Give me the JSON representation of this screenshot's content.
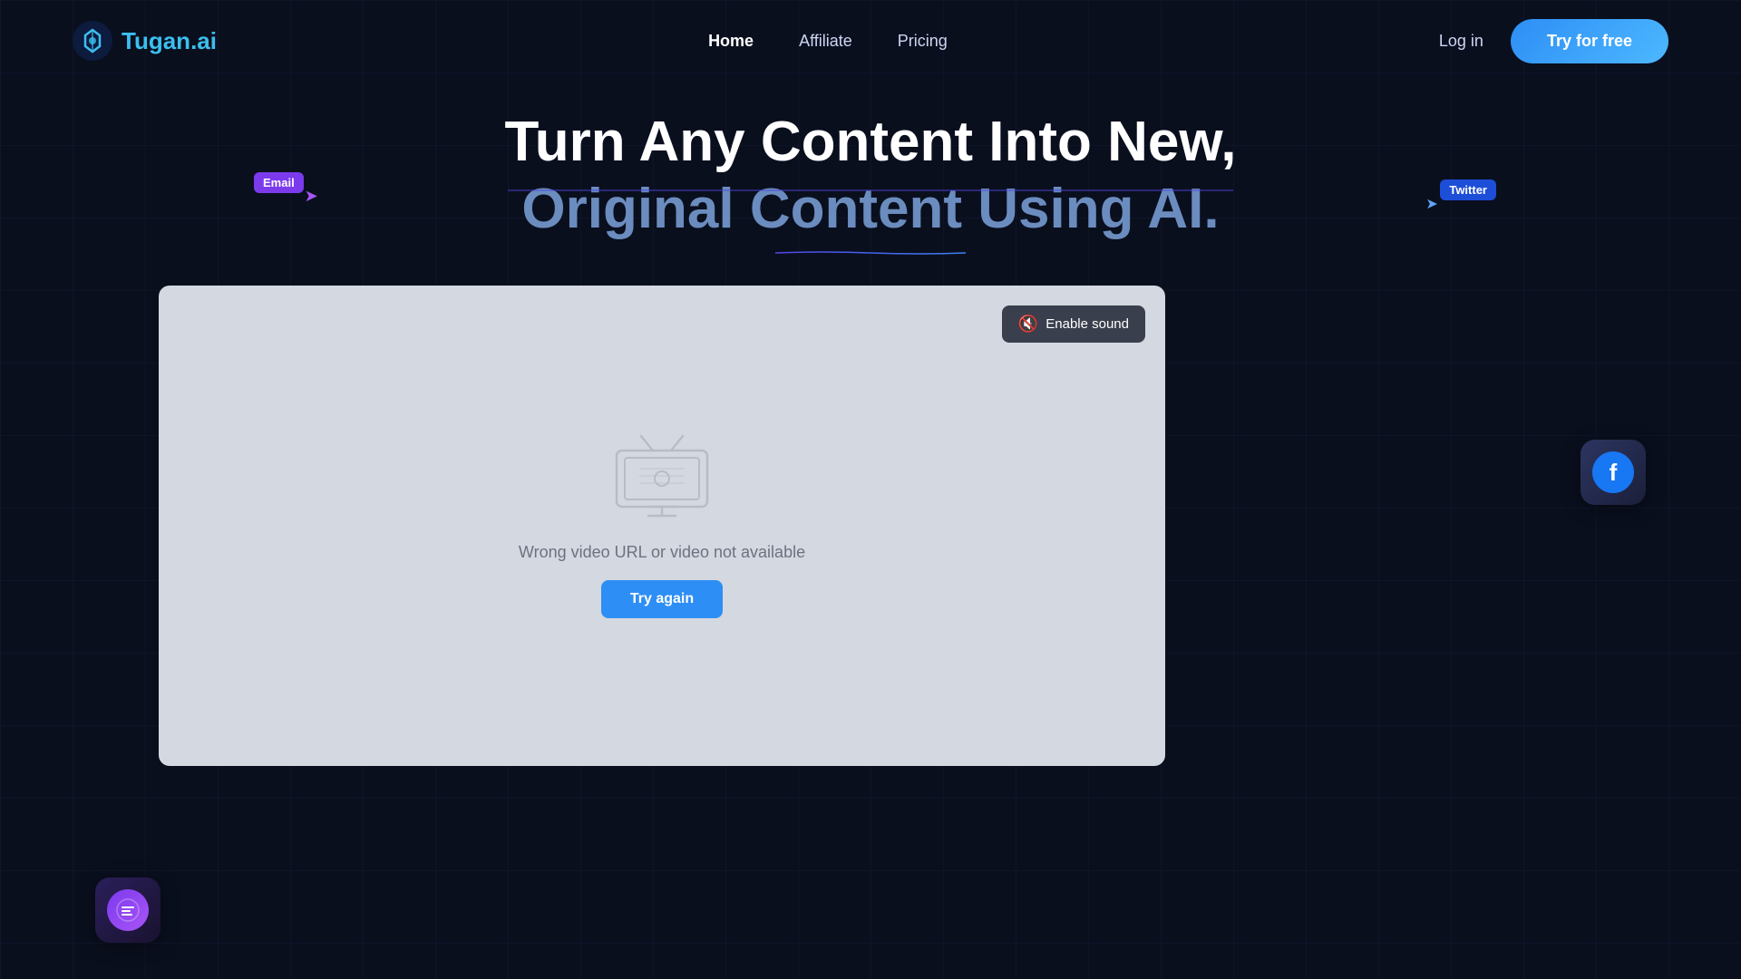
{
  "header": {
    "logo_text_main": "Tugan",
    "logo_text_accent": ".ai",
    "nav": {
      "home": "Home",
      "affiliate": "Affiliate",
      "pricing": "Pricing"
    },
    "login_label": "Log in",
    "try_free_label": "Try for free"
  },
  "hero": {
    "title_line1": "Turn Any Content Into New,",
    "title_line2": "Original Content Using AI.",
    "floating_email_label": "Email",
    "floating_twitter_label": "Twitter"
  },
  "video_player": {
    "enable_sound_label": "Enable sound",
    "error_message": "Wrong video URL or video not available",
    "try_again_label": "Try again"
  },
  "icons": {
    "mute": "🔇",
    "facebook": "f",
    "chat": "≡"
  },
  "colors": {
    "bg": "#0a0f1e",
    "accent_blue": "#2d8ef5",
    "accent_purple": "#7c3aed",
    "video_bg": "#d4d8e0",
    "nav_text": "#cdd6f4"
  }
}
